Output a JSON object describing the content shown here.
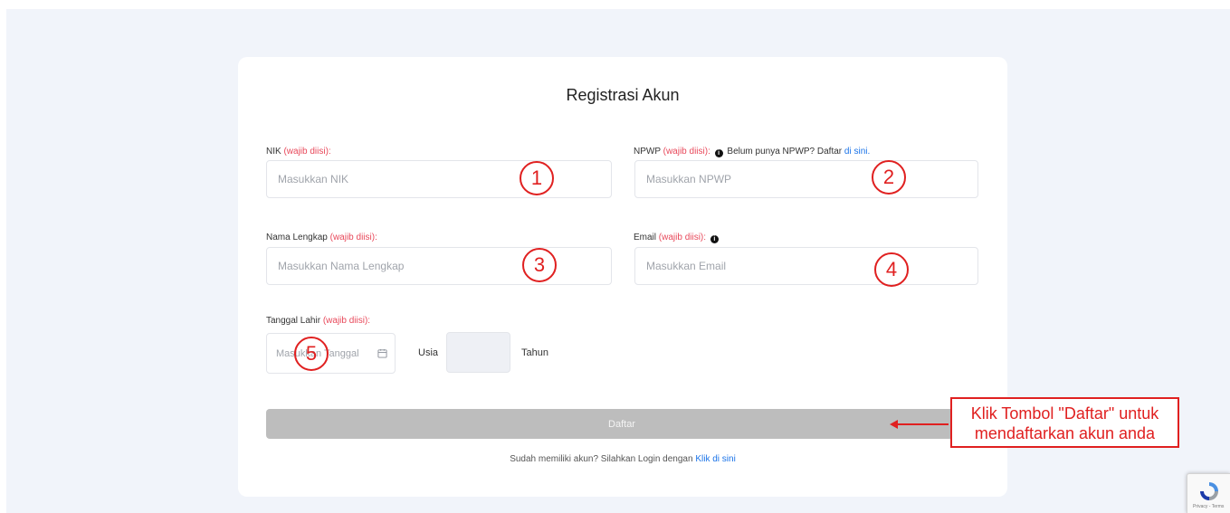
{
  "form": {
    "title": "Registrasi Akun",
    "required_text": "(wajib diisi):",
    "nik": {
      "label": "NIK",
      "placeholder": "Masukkan NIK"
    },
    "npwp": {
      "label": "NPWP",
      "hint": "Belum punya NPWP? Daftar",
      "hint_link": "di sini.",
      "placeholder": "Masukkan NPWP"
    },
    "nama": {
      "label": "Nama Lengkap",
      "placeholder": "Masukkan Nama Lengkap"
    },
    "email": {
      "label": "Email",
      "placeholder": "Masukkan Email"
    },
    "tanggal": {
      "label": "Tanggal Lahir",
      "placeholder": "Masukkan Tanggal"
    },
    "usia_label": "Usia",
    "tahun_label": "Tahun",
    "daftar_label": "Daftar",
    "login_text": "Sudah memiliki akun? Silahkan Login dengan",
    "login_link": "Klik di sini"
  },
  "annotations": {
    "markers": [
      "1",
      "2",
      "3",
      "4",
      "5"
    ],
    "callout": "Klik Tombol \"Daftar\" untuk mendaftarkan akun anda"
  },
  "recaptcha": {
    "footer": "Privacy - Terms"
  },
  "colors": {
    "required": "#e8485a",
    "link": "#1a73e8",
    "annotation": "#e02020",
    "button_disabled": "#bdbdbd",
    "page_background": "#f1f4fa"
  }
}
